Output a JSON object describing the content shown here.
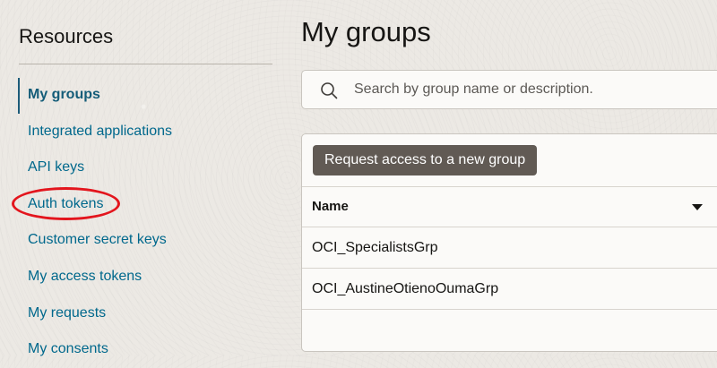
{
  "sidebar": {
    "title": "Resources",
    "items": [
      {
        "label": "My groups",
        "active": true
      },
      {
        "label": "Integrated applications"
      },
      {
        "label": "API keys"
      },
      {
        "label": "Auth tokens",
        "circled": true
      },
      {
        "label": "Customer secret keys"
      },
      {
        "label": "My access tokens"
      },
      {
        "label": "My requests"
      },
      {
        "label": "My consents"
      }
    ]
  },
  "main": {
    "title": "My groups",
    "search": {
      "placeholder": "Search by group name or description.",
      "value": "",
      "icon": "search-icon"
    },
    "request_button_label": "Request access to a new group",
    "table": {
      "columns": [
        {
          "label": "Name",
          "sort_icon": "chevron-down-icon"
        }
      ],
      "rows": [
        {
          "name": "OCI_SpecialistsGrp"
        },
        {
          "name": "OCI_AustineOtienoOumaGrp"
        }
      ]
    }
  },
  "colors": {
    "link": "#00688c",
    "active_link": "#145c78",
    "annotation": "#e3151d",
    "button_bg": "#615a54"
  }
}
